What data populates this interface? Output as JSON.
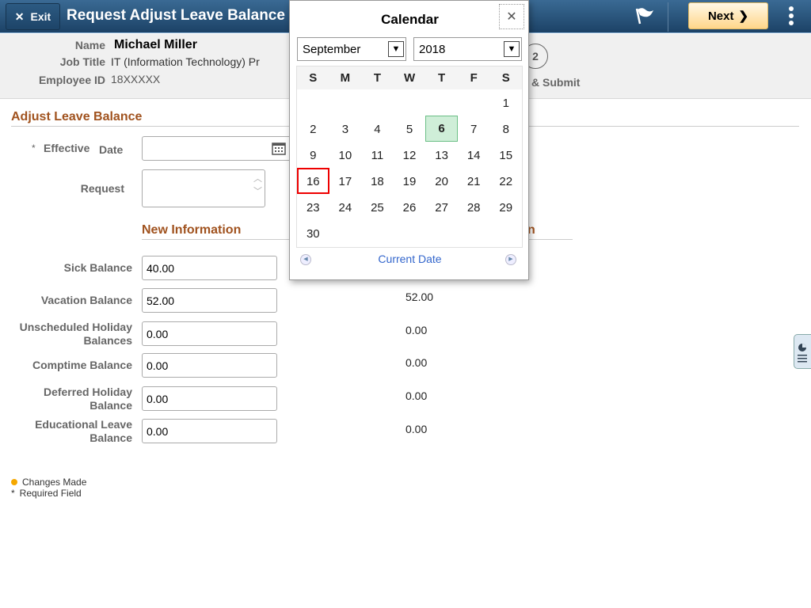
{
  "header": {
    "exit_label": "Exit",
    "title": "Request Adjust Leave Balance",
    "next_label": "Next"
  },
  "employee": {
    "name_label": "Name",
    "name": "Michael Miller",
    "job_label": "Job Title",
    "job": "IT (Information Technology) Pr",
    "id_label": "Employee ID",
    "id": "18XXXXX"
  },
  "steps": {
    "current": "2",
    "label": "& Submit"
  },
  "section": {
    "title": "Adjust Leave Balance",
    "effective_label": "Effective",
    "date_label": "Date",
    "required_mark": "*",
    "request_label": "Request",
    "new_info": "New Information",
    "current_info_partial": "n"
  },
  "balances": [
    {
      "label": "Sick Balance",
      "new": "40.00",
      "current": ""
    },
    {
      "label": "Vacation Balance",
      "new": "52.00",
      "current": "52.00"
    },
    {
      "label": "Unscheduled Holiday Balances",
      "new": "0.00",
      "current": "0.00"
    },
    {
      "label": "Comptime Balance",
      "new": "0.00",
      "current": "0.00"
    },
    {
      "label": "Deferred Holiday Balance",
      "new": "0.00",
      "current": "0.00"
    },
    {
      "label": "Educational Leave Balance",
      "new": "0.00",
      "current": "0.00"
    }
  ],
  "legend": {
    "changes": "Changes Made",
    "required_mark": "*",
    "required": "Required Field",
    "changes_color": "#f5a800"
  },
  "calendar": {
    "title": "Calendar",
    "month": "September",
    "year": "2018",
    "days_of_week": [
      "S",
      "M",
      "T",
      "W",
      "T",
      "F",
      "S"
    ],
    "weeks": [
      [
        "",
        "",
        "",
        "",
        "",
        "",
        "1"
      ],
      [
        "2",
        "3",
        "4",
        "5",
        "6",
        "7",
        "8"
      ],
      [
        "9",
        "10",
        "11",
        "12",
        "13",
        "14",
        "15"
      ],
      [
        "16",
        "17",
        "18",
        "19",
        "20",
        "21",
        "22"
      ],
      [
        "23",
        "24",
        "25",
        "26",
        "27",
        "28",
        "29"
      ],
      [
        "30",
        "",
        "",
        "",
        "",
        "",
        ""
      ]
    ],
    "today": "6",
    "selected": "16",
    "current_date_label": "Current Date"
  }
}
